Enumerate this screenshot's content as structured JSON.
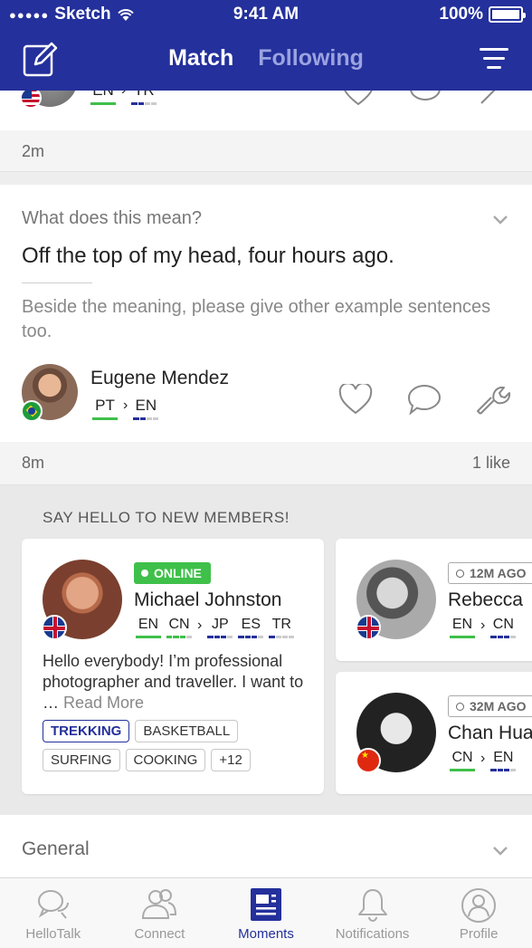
{
  "status_bar": {
    "carrier": "Sketch",
    "time": "9:41 AM",
    "battery": "100%"
  },
  "header": {
    "tabs": [
      {
        "label": "Match"
      },
      {
        "label": "Following"
      }
    ]
  },
  "partial_card": {
    "langs": {
      "native": "EN",
      "learning": "TR"
    }
  },
  "partial_meta": {
    "time": "2m"
  },
  "post": {
    "title": "What does this mean?",
    "text": "Off the top of my head, four hours ago.",
    "note": "Beside the meaning, please give other example sentences too.",
    "author": {
      "name": "Eugene Mendez",
      "native": "PT",
      "learning": "EN"
    },
    "time": "8m",
    "likes": "1 like"
  },
  "new_members": {
    "title": "SAY HELLO TO NEW MEMBERS!",
    "members": [
      {
        "status": "ONLINE",
        "name": "Michael Johnston",
        "langs": [
          "EN",
          "CN",
          "JP",
          "ES",
          "TR"
        ],
        "bio": "Hello everybody! I’m professional photographer and traveller. I want to …",
        "read_more": "Read More",
        "tags": [
          "TREKKING",
          "BASKETBALL",
          "SURFING",
          "COOKING",
          "+12"
        ]
      },
      {
        "status": "12M AGO",
        "name": "Rebecca",
        "langs": [
          "EN",
          "CN"
        ]
      },
      {
        "status": "32M AGO",
        "name": "Chan Hua",
        "langs": [
          "CN",
          "EN"
        ]
      }
    ]
  },
  "general": {
    "label": "General"
  },
  "tabbar": {
    "items": [
      {
        "label": "HelloTalk"
      },
      {
        "label": "Connect"
      },
      {
        "label": "Moments"
      },
      {
        "label": "Notifications"
      },
      {
        "label": "Profile"
      }
    ],
    "active": "Moments"
  },
  "colors": {
    "brand": "#24309b",
    "online": "#3fc04a",
    "native_bar": "#3fc04a",
    "learning_bar": "#24309b"
  }
}
